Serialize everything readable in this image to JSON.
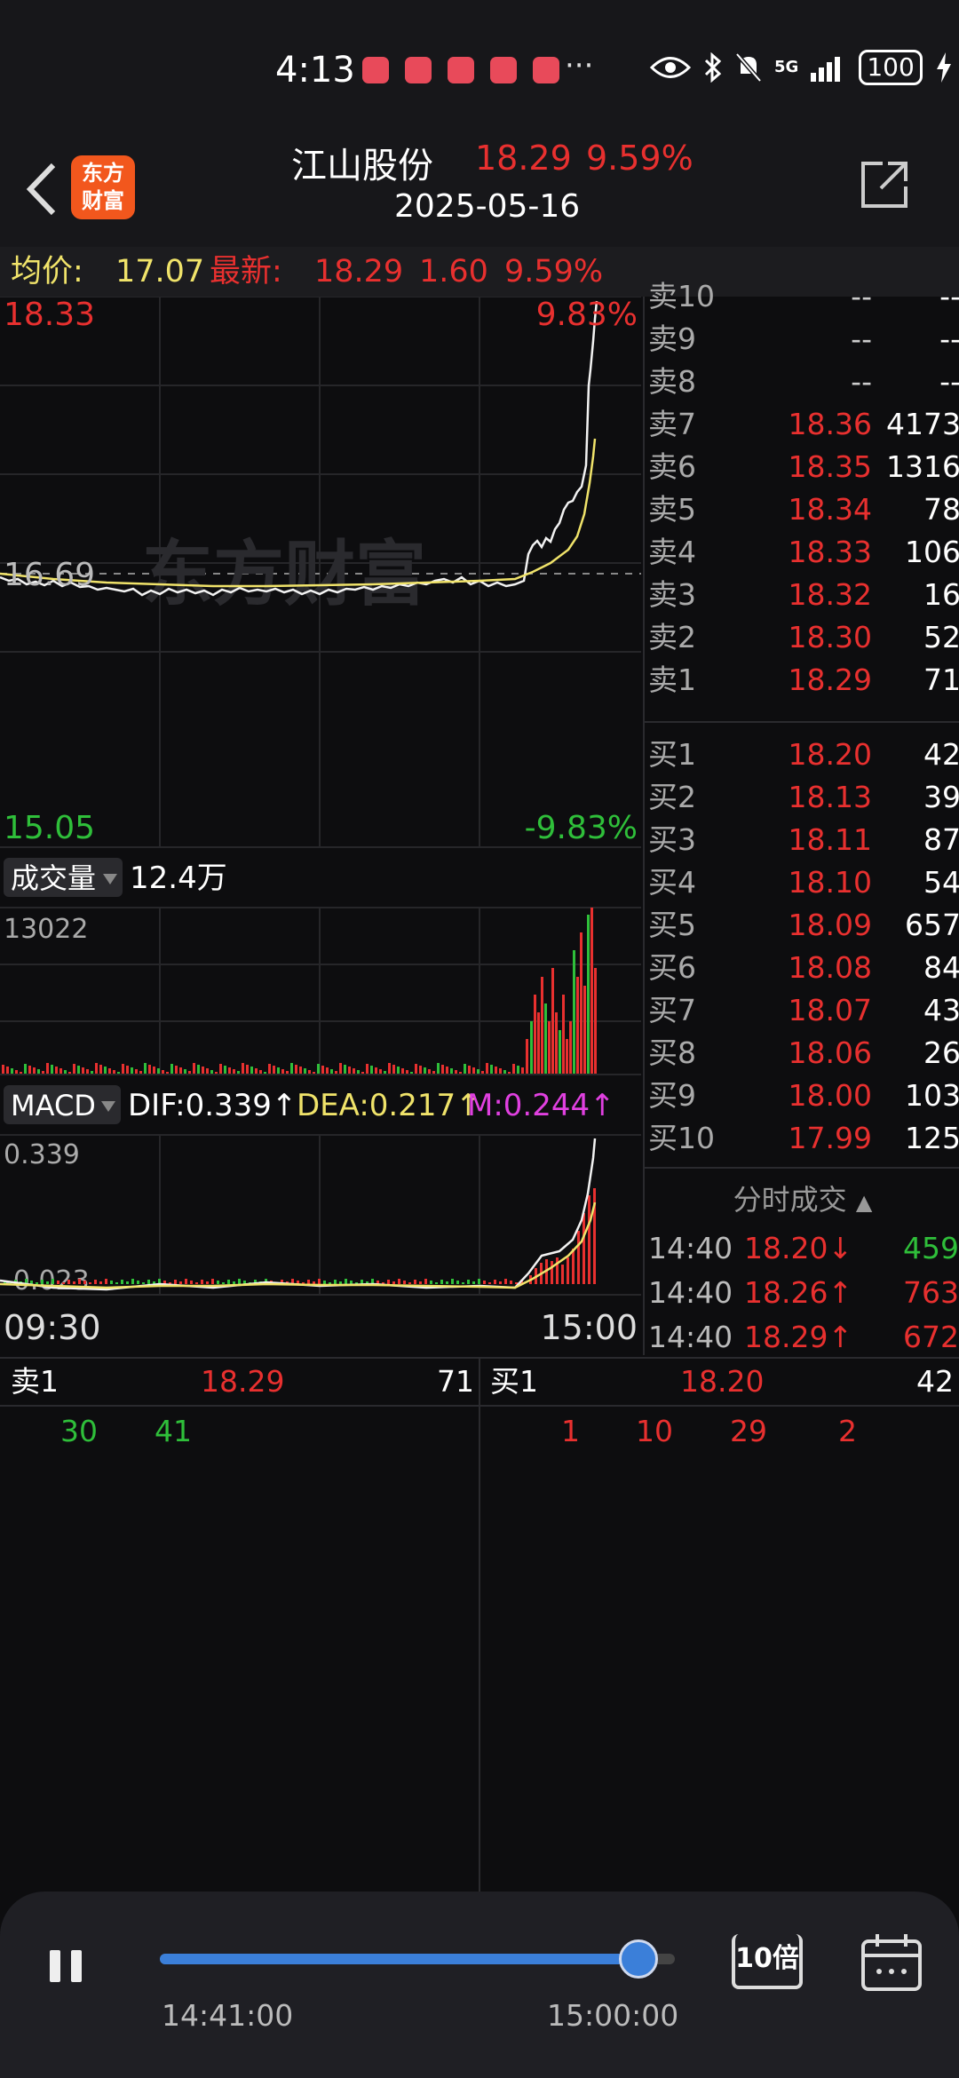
{
  "status_bar": {
    "time": "4:13",
    "dots": "···",
    "network": "5G",
    "battery": "100"
  },
  "header": {
    "logo_line1": "东方",
    "logo_line2": "财富",
    "stock_name": "江山股份",
    "price": "18.29",
    "change_pct": "9.59%",
    "date": "2025-05-16"
  },
  "info_line": {
    "avg_label": "均价:",
    "avg_value": "17.07",
    "latest_label": "最新:",
    "latest_value": "18.29",
    "change": "1.60",
    "change_pct": "9.59%"
  },
  "price_chart": {
    "high_label": "18.33",
    "high_pct": "9.83%",
    "prev_close": "16.69",
    "low_label": "15.05",
    "low_pct": "-9.83%",
    "watermark": "东方财富"
  },
  "volume_panel": {
    "indicator": "成交量",
    "total": "12.4万",
    "max_label": "13022"
  },
  "macd_panel": {
    "indicator": "MACD",
    "dif": "DIF:0.339↑",
    "dea": "DEA:0.217↑",
    "m": "M:0.244↑",
    "top_label": "0.339",
    "bottom_label": "-0.023",
    "time_start": "09:30",
    "time_end": "15:00"
  },
  "order_book": {
    "asks": [
      {
        "label": "卖10",
        "price": "--",
        "vol": "--"
      },
      {
        "label": "卖9",
        "price": "--",
        "vol": "--"
      },
      {
        "label": "卖8",
        "price": "--",
        "vol": "--"
      },
      {
        "label": "卖7",
        "price": "18.36",
        "vol": "4173"
      },
      {
        "label": "卖6",
        "price": "18.35",
        "vol": "1316"
      },
      {
        "label": "卖5",
        "price": "18.34",
        "vol": "78"
      },
      {
        "label": "卖4",
        "price": "18.33",
        "vol": "106"
      },
      {
        "label": "卖3",
        "price": "18.32",
        "vol": "16"
      },
      {
        "label": "卖2",
        "price": "18.30",
        "vol": "52"
      },
      {
        "label": "卖1",
        "price": "18.29",
        "vol": "71"
      }
    ],
    "bids": [
      {
        "label": "买1",
        "price": "18.20",
        "vol": "42"
      },
      {
        "label": "买2",
        "price": "18.13",
        "vol": "39"
      },
      {
        "label": "买3",
        "price": "18.11",
        "vol": "87"
      },
      {
        "label": "买4",
        "price": "18.10",
        "vol": "54"
      },
      {
        "label": "买5",
        "price": "18.09",
        "vol": "657"
      },
      {
        "label": "买6",
        "price": "18.08",
        "vol": "84"
      },
      {
        "label": "买7",
        "price": "18.07",
        "vol": "43"
      },
      {
        "label": "买8",
        "price": "18.06",
        "vol": "26"
      },
      {
        "label": "买9",
        "price": "18.00",
        "vol": "103"
      },
      {
        "label": "买10",
        "price": "17.99",
        "vol": "125"
      }
    ]
  },
  "ticks": {
    "title": "分时成交",
    "rows": [
      {
        "time": "14:40",
        "price": "18.20↓",
        "vol": "459",
        "dir": "down"
      },
      {
        "time": "14:40",
        "price": "18.26↑",
        "vol": "763",
        "dir": "up"
      },
      {
        "time": "14:40",
        "price": "18.29↑",
        "vol": "672",
        "dir": "up"
      }
    ]
  },
  "queue": {
    "ask_label": "卖1",
    "ask_price": "18.29",
    "ask_vol": "71",
    "bid_label": "买1",
    "bid_price": "18.20",
    "bid_vol": "42",
    "ask_orders": [
      "30",
      "41"
    ],
    "bid_orders": [
      "1",
      "10",
      "29",
      "2"
    ]
  },
  "player": {
    "progress": 0.93,
    "start_time": "14:41:00",
    "end_time": "15:00:00",
    "speed": "10倍"
  },
  "colors": {
    "up": "#e8302f",
    "down": "#2fbf3a",
    "avg_line": "#f0e36a",
    "accent": "#3b7fd9"
  }
}
